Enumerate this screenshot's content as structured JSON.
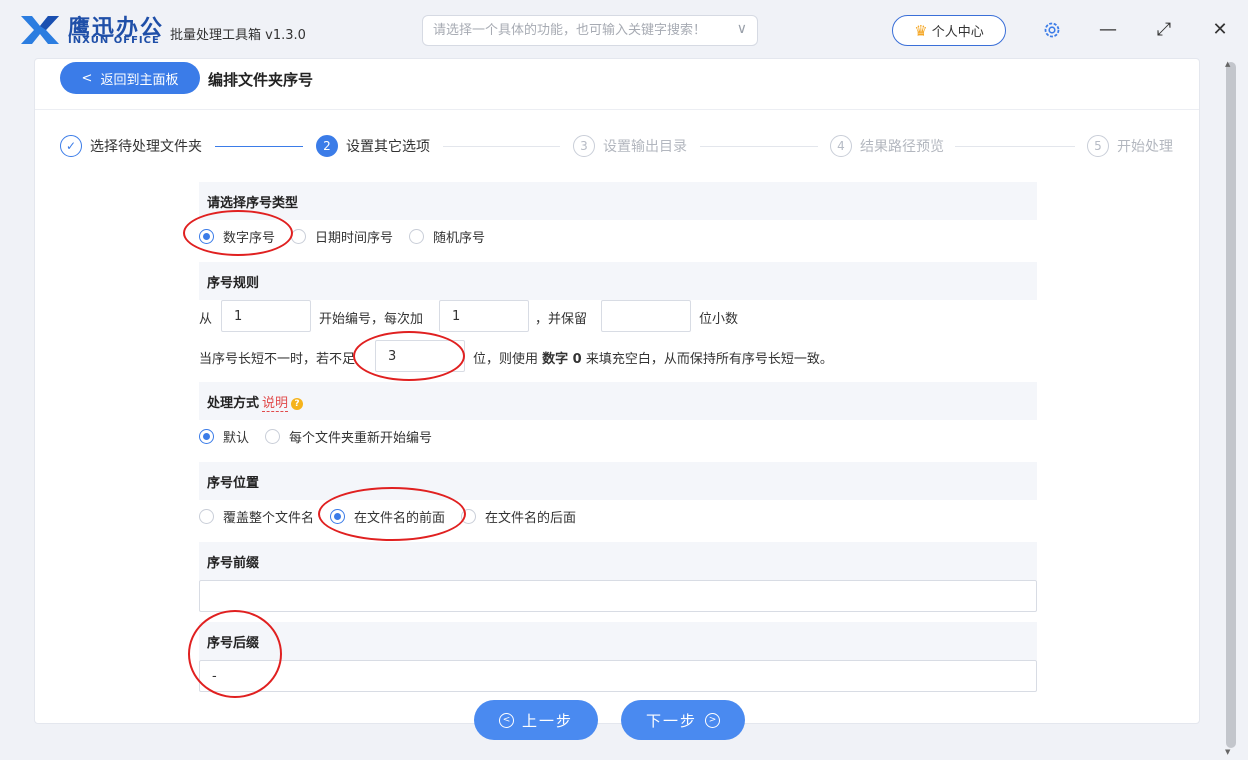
{
  "titlebar": {
    "brand_cn": "鹰迅办公",
    "brand_en": "INXUN OFFICE",
    "app_title": "批量处理工具箱 v1.3.0",
    "search_placeholder": "请选择一个具体的功能，也可输入关键字搜索！",
    "user_center": "个人中心"
  },
  "header": {
    "back_label": "返回到主面板",
    "page_title": "编排文件夹序号"
  },
  "steps": [
    {
      "num": "✓",
      "label": "选择待处理文件夹",
      "state": "done"
    },
    {
      "num": "2",
      "label": "设置其它选项",
      "state": "active"
    },
    {
      "num": "3",
      "label": "设置输出目录",
      "state": "pending"
    },
    {
      "num": "4",
      "label": "结果路径预览",
      "state": "pending"
    },
    {
      "num": "5",
      "label": "开始处理",
      "state": "pending"
    }
  ],
  "form": {
    "type_section": {
      "title": "请选择序号类型",
      "options": [
        "数字序号",
        "日期时间序号",
        "随机序号"
      ],
      "selected": "数字序号"
    },
    "rule_section": {
      "title": "序号规则",
      "from_label": "从",
      "start_value": "1",
      "start_text": "开始编号，每次加",
      "step_value": "1",
      "keep_text": "，并保留",
      "decimals_value": "",
      "decimals_text": "位小数",
      "pad_prefix": "当序号长短不一时，若不足",
      "pad_value": "3",
      "pad_suffix_1": "位，则使用",
      "pad_bold": "数字 0",
      "pad_suffix_2": "来填充空白，从而保持所有序号长短一致。"
    },
    "mode_section": {
      "title": "处理方式",
      "help_link": "说明",
      "options": [
        "默认",
        "每个文件夹重新开始编号"
      ],
      "selected": "默认"
    },
    "position_section": {
      "title": "序号位置",
      "options": [
        "覆盖整个文件名",
        "在文件名的前面",
        "在文件名的后面"
      ],
      "selected": "在文件名的前面"
    },
    "prefix_section": {
      "title": "序号前缀",
      "value": ""
    },
    "suffix_section": {
      "title": "序号后缀",
      "value": "-"
    }
  },
  "footer": {
    "prev_label": "上一步",
    "next_label": "下一步"
  },
  "colors": {
    "accent": "#3b7ce8",
    "annotation": "#e02020"
  }
}
